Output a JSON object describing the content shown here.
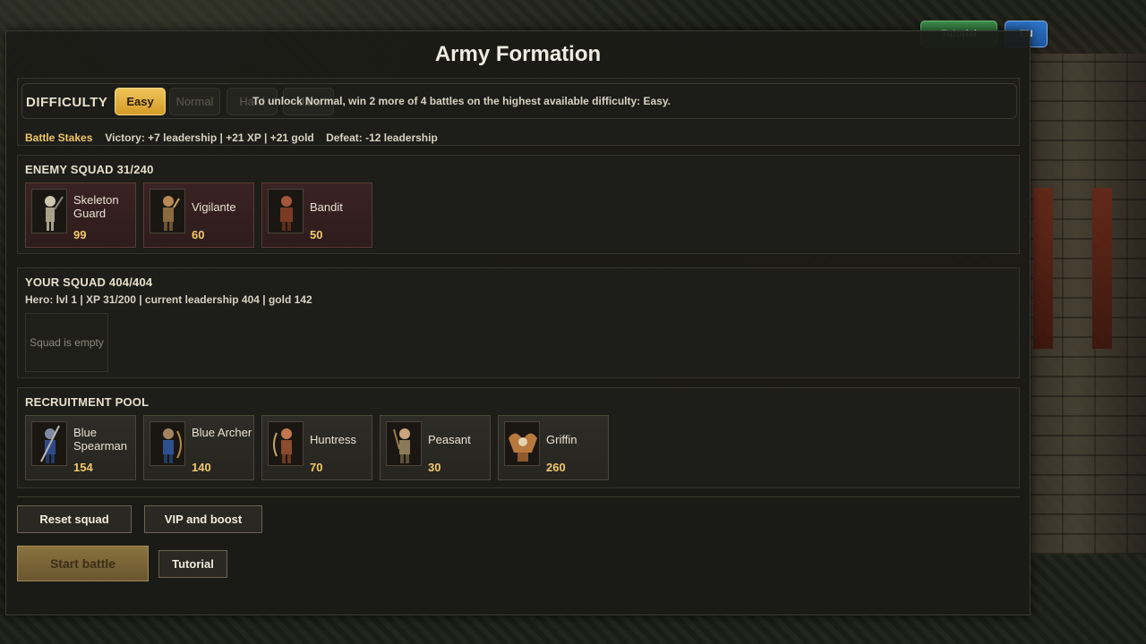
{
  "top_bar": {
    "tutorial_label": "Tutorial",
    "language_label": "EN"
  },
  "title": "Army Formation",
  "difficulty": {
    "label": "DIFFICULTY",
    "options": [
      "Easy",
      "Normal",
      "Hard",
      "Ultra"
    ],
    "selected": "Easy",
    "note": "To unlock Normal, win 2 more of 4 battles on the highest available difficulty: Easy."
  },
  "battle_stakes": {
    "label": "Battle Stakes",
    "text": "Victory: +7 leadership | +21 XP | +21 gold    Defeat: -12 leadership"
  },
  "enemy_squad": {
    "header": "ENEMY SQUAD 31/240",
    "units": [
      {
        "name": "Skeleton Guard",
        "count": "99",
        "icon": "skeleton-guard-icon"
      },
      {
        "name": "Vigilante",
        "count": "60",
        "icon": "vigilante-icon"
      },
      {
        "name": "Bandit",
        "count": "50",
        "icon": "bandit-icon"
      }
    ]
  },
  "your_squad": {
    "header": "YOUR SQUAD 404/404",
    "hero_info": "Hero: lvl 1 | XP 31/200 | current leadership 404 | gold 142",
    "empty_text": "Squad is empty"
  },
  "recruitment_pool": {
    "header": "RECRUITMENT POOL",
    "units": [
      {
        "name": "Blue Spearman",
        "cost": "154",
        "icon": "blue-spearman-icon"
      },
      {
        "name": "Blue Archer",
        "cost": "140",
        "icon": "blue-archer-icon"
      },
      {
        "name": "Huntress",
        "cost": "70",
        "icon": "huntress-icon"
      },
      {
        "name": "Peasant",
        "cost": "30",
        "icon": "peasant-icon"
      },
      {
        "name": "Griffin",
        "cost": "260",
        "icon": "griffin-icon"
      }
    ]
  },
  "actions": {
    "reset": "Reset squad",
    "vip": "VIP and boost",
    "start": "Start battle",
    "tutorial": "Tutorial"
  },
  "colors": {
    "accent_gold": "#f0c45a",
    "cost_gold": "#f3c96a",
    "tutorial_green": "#3f8f4c",
    "language_blue": "#2f74c7"
  }
}
